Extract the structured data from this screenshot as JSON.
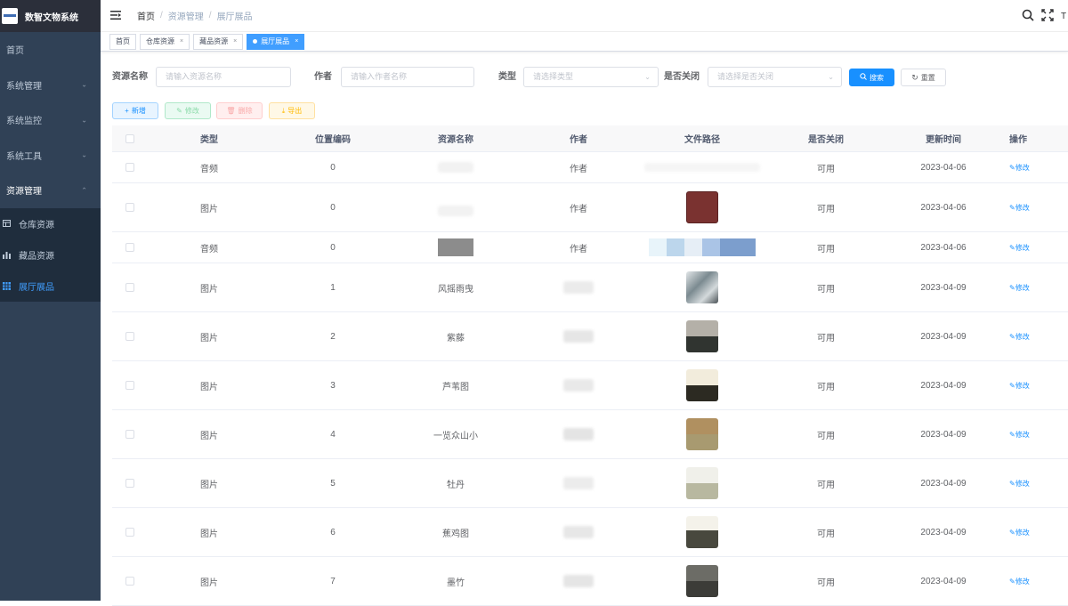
{
  "app": {
    "title": "数智文物系统"
  },
  "sidebar": {
    "items": [
      {
        "label": "首页"
      },
      {
        "label": "系统管理"
      },
      {
        "label": "系统监控"
      },
      {
        "label": "系统工具"
      },
      {
        "label": "资源管理"
      }
    ],
    "subitems": [
      {
        "label": "仓库资源",
        "icon": "table-icon"
      },
      {
        "label": "藏品资源",
        "icon": "chart-icon"
      },
      {
        "label": "展厅展品",
        "icon": "grid-icon"
      }
    ]
  },
  "breadcrumb": [
    "首页",
    "资源管理",
    "展厅展品"
  ],
  "tags": [
    {
      "label": "首页"
    },
    {
      "label": "仓库资源"
    },
    {
      "label": "藏品资源"
    },
    {
      "label": "展厅展品"
    }
  ],
  "search": {
    "name_label": "资源名称",
    "name_placeholder": "请输入资源名称",
    "author_label": "作者",
    "author_placeholder": "请输入作者名称",
    "type_label": "类型",
    "type_placeholder": "请选择类型",
    "close_label": "是否关闭",
    "close_placeholder": "请选择是否关闭",
    "search_btn": "搜索",
    "reset_btn": "重置"
  },
  "toolbar": {
    "add": "新增",
    "edit": "修改",
    "delete": "删除",
    "export": "导出"
  },
  "table": {
    "columns": [
      "类型",
      "位置编码",
      "资源名称",
      "作者",
      "文件路径",
      "是否关闭",
      "更新时间",
      "操作"
    ],
    "rows": [
      {
        "type": "音频",
        "pos": "0",
        "name": "",
        "author": "作者",
        "status": "可用",
        "time": "2023-04-06",
        "op": "修改"
      },
      {
        "type": "图片",
        "pos": "0",
        "name": "",
        "author": "作者",
        "status": "可用",
        "time": "2023-04-06",
        "op": "修改"
      },
      {
        "type": "音频",
        "pos": "0",
        "name": "",
        "author": "作者",
        "status": "可用",
        "time": "2023-04-06",
        "op": "修改"
      },
      {
        "type": "图片",
        "pos": "1",
        "name": "风摇雨曳",
        "author": "",
        "status": "可用",
        "time": "2023-04-09",
        "op": "修改"
      },
      {
        "type": "图片",
        "pos": "2",
        "name": "紫藤",
        "author": "",
        "status": "可用",
        "time": "2023-04-09",
        "op": "修改"
      },
      {
        "type": "图片",
        "pos": "3",
        "name": "芦苇图",
        "author": "",
        "status": "可用",
        "time": "2023-04-09",
        "op": "修改"
      },
      {
        "type": "图片",
        "pos": "4",
        "name": "一览众山小",
        "author": "",
        "status": "可用",
        "time": "2023-04-09",
        "op": "修改"
      },
      {
        "type": "图片",
        "pos": "5",
        "name": "牡丹",
        "author": "",
        "status": "可用",
        "time": "2023-04-09",
        "op": "修改"
      },
      {
        "type": "图片",
        "pos": "6",
        "name": "蕉鸡图",
        "author": "",
        "status": "可用",
        "time": "2023-04-09",
        "op": "修改"
      },
      {
        "type": "图片",
        "pos": "7",
        "name": "墨竹",
        "author": "",
        "status": "可用",
        "time": "2023-04-09",
        "op": "修改"
      }
    ]
  }
}
